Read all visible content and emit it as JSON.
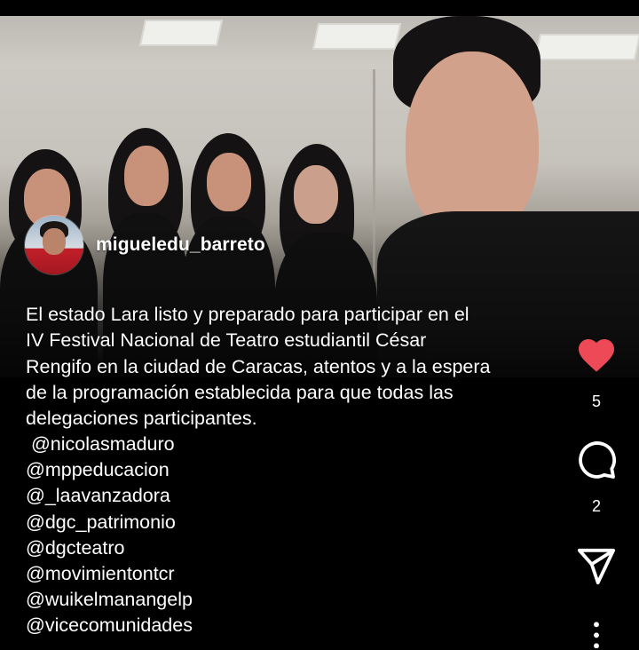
{
  "post": {
    "username": "migueledu_barreto",
    "caption_lines": [
      "El estado Lara listo y preparado para participar en el",
      "IV Festival Nacional  de Teatro estudiantil César",
      "Rengifo en la ciudad de Caracas, atentos y a la espera",
      "de la programación establecida para que todas las",
      "delegaciones participantes."
    ],
    "mentions": [
      " @nicolasmaduro",
      "@mppeducacion",
      "@_laavanzadora",
      "@dgc_patrimonio",
      "@dgcteatro",
      "@movimientontcr",
      "@wuikelmanangelp",
      "@vicecomunidades"
    ]
  },
  "actions": {
    "like": {
      "icon": "heart-icon",
      "count": "5",
      "color": "#ed4956",
      "liked": true
    },
    "comment": {
      "icon": "comment-bubble-icon",
      "count": "2"
    },
    "share": {
      "icon": "send-paper-plane-icon"
    },
    "more": {
      "icon": "more-vertical-icon"
    }
  }
}
